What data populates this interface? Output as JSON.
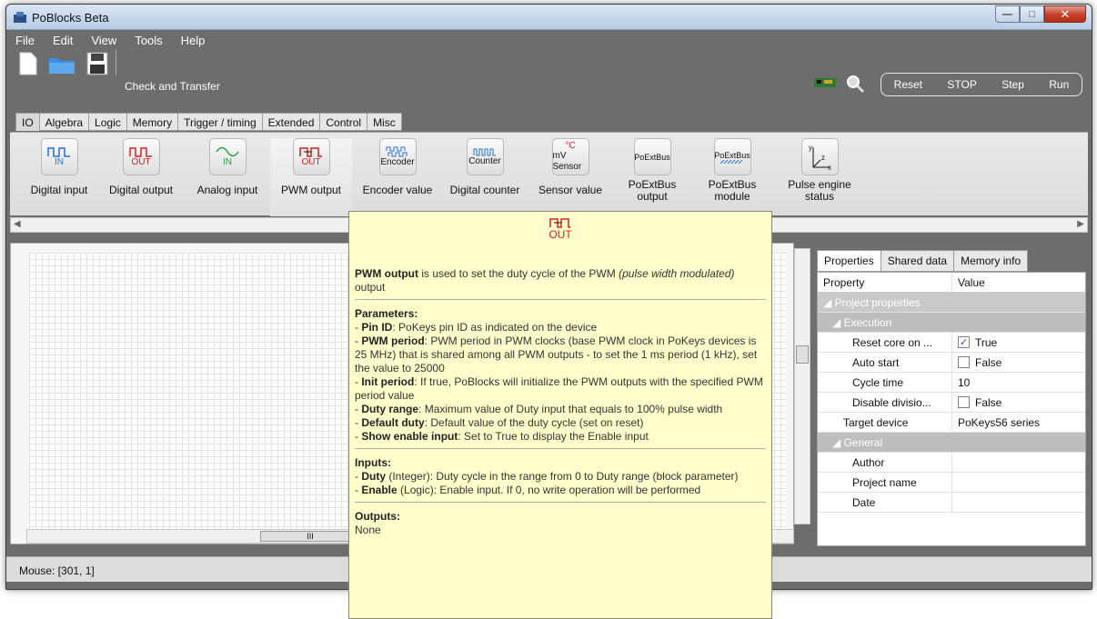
{
  "window": {
    "title": "PoBlocks Beta"
  },
  "menu": [
    "File",
    "Edit",
    "View",
    "Tools",
    "Help"
  ],
  "toolbar": {
    "check_transfer": "Check and Transfer",
    "run": [
      "Reset",
      "STOP",
      "Step",
      "Run"
    ]
  },
  "ribbon_tabs": [
    "IO",
    "Algebra",
    "Logic",
    "Memory",
    "Trigger / timing",
    "Extended",
    "Control",
    "Misc"
  ],
  "blocks": [
    {
      "icon": "IN",
      "label": "Digital input"
    },
    {
      "icon": "OUT",
      "label": "Digital output"
    },
    {
      "icon": "IN",
      "label": "Analog input"
    },
    {
      "icon": "OUT",
      "label": "PWM output"
    },
    {
      "icon": "Encoder",
      "label": "Encoder value"
    },
    {
      "icon": "Counter",
      "label": "Digital counter"
    },
    {
      "icon": "mV Sensor",
      "label": "Sensor value"
    },
    {
      "icon": "PoExtBus",
      "label": "PoExtBus output"
    },
    {
      "icon": "PoExtBus",
      "label": "PoExtBus module"
    },
    {
      "icon": "z x",
      "label": "Pulse engine status"
    }
  ],
  "canvas": {
    "hscroll_thumb": "III"
  },
  "properties": {
    "tabs": [
      "Properties",
      "Shared data",
      "Memory info"
    ],
    "header": {
      "name": "Property",
      "value": "Value"
    },
    "groups": {
      "project": "Project properties",
      "execution": "Execution",
      "general": "General"
    },
    "rows": {
      "reset_core": {
        "name": "Reset core on ...",
        "value": "True"
      },
      "auto_start": {
        "name": "Auto start",
        "value": "False"
      },
      "cycle_time": {
        "name": "Cycle time",
        "value": "10"
      },
      "disable_div": {
        "name": "Disable divisio...",
        "value": "False"
      },
      "target_device": {
        "name": "Target device",
        "value": "PoKeys56 series"
      },
      "author": {
        "name": "Author",
        "value": ""
      },
      "project_name": {
        "name": "Project name",
        "value": ""
      },
      "date": {
        "name": "Date",
        "value": ""
      }
    }
  },
  "status": {
    "mouse": "Mouse: [301, 1]"
  },
  "tooltip": {
    "icon_label": "OUT",
    "intro_bold": "PWM output",
    "intro_rest": " is used to set the duty cycle of the PWM ",
    "intro_em": "(pulse width modulated)",
    "intro_end": " output",
    "params_title": "Parameters:",
    "params": [
      {
        "b": "Pin ID",
        "t": ": PoKeys pin ID as indicated on the device"
      },
      {
        "b": "PWM period",
        "t": ": PWM period in PWM clocks (base PWM clock in PoKeys devices is 25 MHz) that is shared among all PWM outputs - to set the 1 ms period (1 kHz), set the value to 25000"
      },
      {
        "b": "Init period",
        "t": ": If true, PoBlocks will initialize the PWM outputs with the specified PWM period value"
      },
      {
        "b": "Duty range",
        "t": ": Maximum value of Duty input that equals to 100% pulse width"
      },
      {
        "b": "Default duty",
        "t": ": Default value of the duty cycle (set on reset)"
      },
      {
        "b": "Show enable input",
        "t": ": Set to True to display the Enable input"
      }
    ],
    "inputs_title": "Inputs:",
    "inputs": [
      {
        "b": "Duty",
        "t": " (Integer): Duty cycle in the range from 0 to Duty range (block parameter)"
      },
      {
        "b": "Enable",
        "t": " (Logic): Enable input. If 0, no write operation will be performed"
      }
    ],
    "outputs_title": "Outputs:",
    "outputs": "None"
  },
  "colors": {
    "accent_blue": "#2a6fd6",
    "accent_red": "#d42020",
    "accent_green": "#2f9e3f",
    "tooltip_bg": "#ffffcc"
  }
}
